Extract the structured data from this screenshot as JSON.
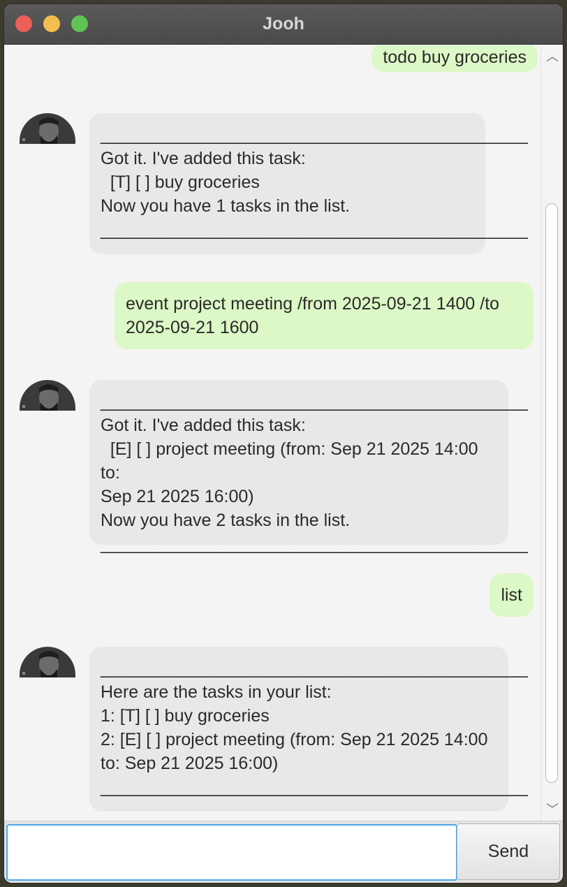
{
  "window": {
    "title": "Jooh"
  },
  "messages": [
    {
      "sender": "user",
      "text": "todo buy groceries"
    },
    {
      "sender": "bot",
      "text": "____________________________________________\nGot it. I've added this task:\n  [T] [ ] buy groceries\nNow you have 1 tasks in the list.\n____________________________________________"
    },
    {
      "sender": "user",
      "text": "event project meeting /from 2025-09-21 1400 /to\n2025-09-21 1600"
    },
    {
      "sender": "bot",
      "text": "____________________________________________\nGot it. I've added this task:\n  [E] [ ] project meeting (from: Sep 21 2025 14:00 to:\nSep 21 2025 16:00)\nNow you have 2 tasks in the list.\n____________________________________________"
    },
    {
      "sender": "user",
      "text": "list"
    },
    {
      "sender": "bot",
      "text": "____________________________________________\nHere are the tasks in your list:\n1: [T] [ ] buy groceries\n2: [E] [ ] project meeting (from: Sep 21 2025 14:00\nto: Sep 21 2025 16:00)\n____________________________________________"
    }
  ],
  "input": {
    "value": "",
    "placeholder": ""
  },
  "send_button": {
    "label": "Send"
  },
  "colors": {
    "user_bubble": "#dcf8c6",
    "bot_bubble": "#e8e8e8",
    "focus_border": "#4aa6e8"
  }
}
